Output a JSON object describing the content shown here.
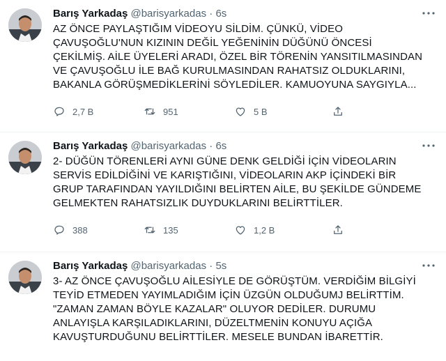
{
  "tweets": [
    {
      "name": "Barış Yarkadaş",
      "handle": "@barisyarkadas",
      "time": "6s",
      "lines": [
        "AZ ÖNCE PAYLAŞTIĞIM VİDEOYU SİLDİM. ÇÜNKÜ, VİDEO",
        "ÇAVUŞOĞLU'NUN KIZININ DEĞİL YEĞENİNİN DÜĞÜNÜ ÖNCESİ",
        "ÇEKİLMİŞ. AİLE ÜYELERİ ARADI, ÖZEL BİR TÖRENİN YANSITILMASINDAN",
        "VE ÇAVUŞOĞLU İLE BAĞ KURULMASINDAN RAHATSIZ OLDUKLARINI,",
        "BAKANLA GÖRÜŞMEDİKLERİNİ SÖYLEDİLER. KAMUOYUNA SAYGIYLA..."
      ],
      "replies": "2,7 B",
      "retweets": "951",
      "likes": "5 B"
    },
    {
      "name": "Barış Yarkadaş",
      "handle": "@barisyarkadas",
      "time": "6s",
      "lines": [
        "2- DÜĞÜN TÖRENLERİ AYNI GÜNE DENK GELDİĞİ İÇİN VİDEOLARIN",
        "SERVİS EDİLDİĞİNİ VE KARIŞTIĞINI, VİDEOLARIN AKP İÇİNDEKİ BİR",
        "GRUP TARAFINDAN YAYILDIĞINI BELİRTEN AİLE, BU ŞEKİLDE GÜNDEME",
        "GELMEKTEN RAHATSIZLIK DUYDUKLARINI BELİRTTİLER."
      ],
      "replies": "388",
      "retweets": "135",
      "likes": "1,2 B"
    },
    {
      "name": "Barış Yarkadaş",
      "handle": "@barisyarkadas",
      "time": "5s",
      "lines": [
        "3- AZ ÖNCE ÇAVUŞOĞLU AİLESİYLE DE GÖRÜŞTÜM. VERDİĞİM BİLGİYİ",
        "TEYİD ETMEDEN YAYIMLADIĞIM İÇİN ÜZGÜN OLDUĞUMJ BELİRTTİM.",
        "\"ZAMAN ZAMAN BÖYLE KAZALAR\" OLUYOR DEDİLER. DURUMU",
        "ANLAYIŞLA KARŞILADIKLARINI, DÜZELTMENİN KONUYU AÇIĞA",
        "KAVUŞTURDUĞUNU BELİRTTİLER. MESELE BUNDAN İBARETTİR."
      ],
      "replies": "",
      "retweets": "",
      "likes": ""
    }
  ],
  "separator": "·",
  "colors": {
    "text": "#0f1419",
    "muted": "#536471",
    "divider": "#eff3f4"
  }
}
